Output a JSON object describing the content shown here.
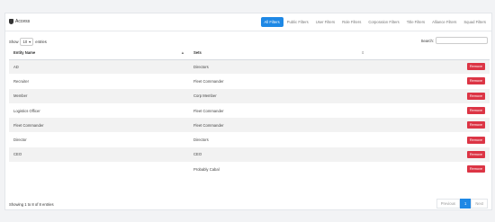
{
  "header": {
    "title": "Access",
    "icon": "shield-icon"
  },
  "tabs": [
    {
      "label": "All Filters",
      "active": true
    },
    {
      "label": "Public Filters",
      "active": false
    },
    {
      "label": "User Filters",
      "active": false
    },
    {
      "label": "Role Filters",
      "active": false
    },
    {
      "label": "Corporation Filters",
      "active": false
    },
    {
      "label": "Title Filters",
      "active": false
    },
    {
      "label": "Alliance Filters",
      "active": false
    },
    {
      "label": "Squad Filters",
      "active": false
    }
  ],
  "controls": {
    "show_label": "Show",
    "entries_value": "10",
    "entries_label": "entries",
    "search_label": "Search:"
  },
  "table": {
    "columns": [
      "Entity Name",
      "Sets",
      ""
    ],
    "rows": [
      {
        "entity": "AD",
        "set": "Directors",
        "action": "Remove"
      },
      {
        "entity": "Recruiter",
        "set": "Fleet Commander",
        "action": "Remove"
      },
      {
        "entity": "Member",
        "set": "Corp Member",
        "action": "Remove"
      },
      {
        "entity": "Logistics Officer",
        "set": "Fleet Commander",
        "action": "Remove"
      },
      {
        "entity": "Fleet Commander",
        "set": "Fleet Commander",
        "action": "Remove"
      },
      {
        "entity": "Director",
        "set": "Directors",
        "action": "Remove"
      },
      {
        "entity": "CEO",
        "set": "CEO",
        "action": "Remove"
      },
      {
        "entity": "",
        "set": "Probably Cabal",
        "action": "Remove"
      }
    ]
  },
  "footer": {
    "info": "Showing 1 to 8 of 8 entries",
    "prev": "Previous",
    "page": "1",
    "next": "Next"
  },
  "colors": {
    "accent": "#1e88e5",
    "danger": "#dc3545"
  }
}
